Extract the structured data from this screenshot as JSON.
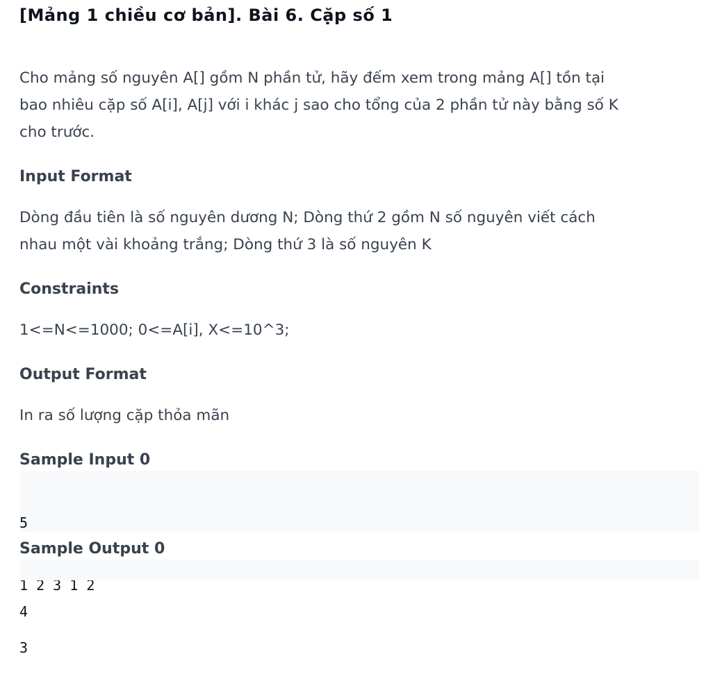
{
  "problem": {
    "title": "[Mảng 1 chiều cơ bản]. Bài 6. Cặp số 1",
    "statement_lines": [
      "Cho mảng số nguyên A[] gồm N phần tử, hãy đếm xem trong mảng A[] tồn tại",
      "bao nhiêu cặp số A[i], A[j] với i khác j sao cho tổng của 2 phần tử này bằng số K",
      "cho trước."
    ],
    "input_format": {
      "heading": "Input Format",
      "lines": [
        "Dòng đầu tiên là số nguyên dương N; Dòng thứ 2 gồm N số nguyên viết cách",
        "nhau một vài khoảng trắng; Dòng thứ 3 là số nguyên K"
      ]
    },
    "constraints": {
      "heading": "Constraints",
      "text": "1<=N<=1000; 0<=A[i], X<=10^3;"
    },
    "output_format": {
      "heading": "Output Format",
      "text": "In ra số lượng cặp thỏa mãn"
    },
    "sample_input": {
      "heading": "Sample Input 0",
      "lines": [
        "5",
        "1 2 3 1 2",
        "3"
      ]
    },
    "sample_output": {
      "heading": "Sample Output 0",
      "lines": [
        "4"
      ]
    }
  }
}
